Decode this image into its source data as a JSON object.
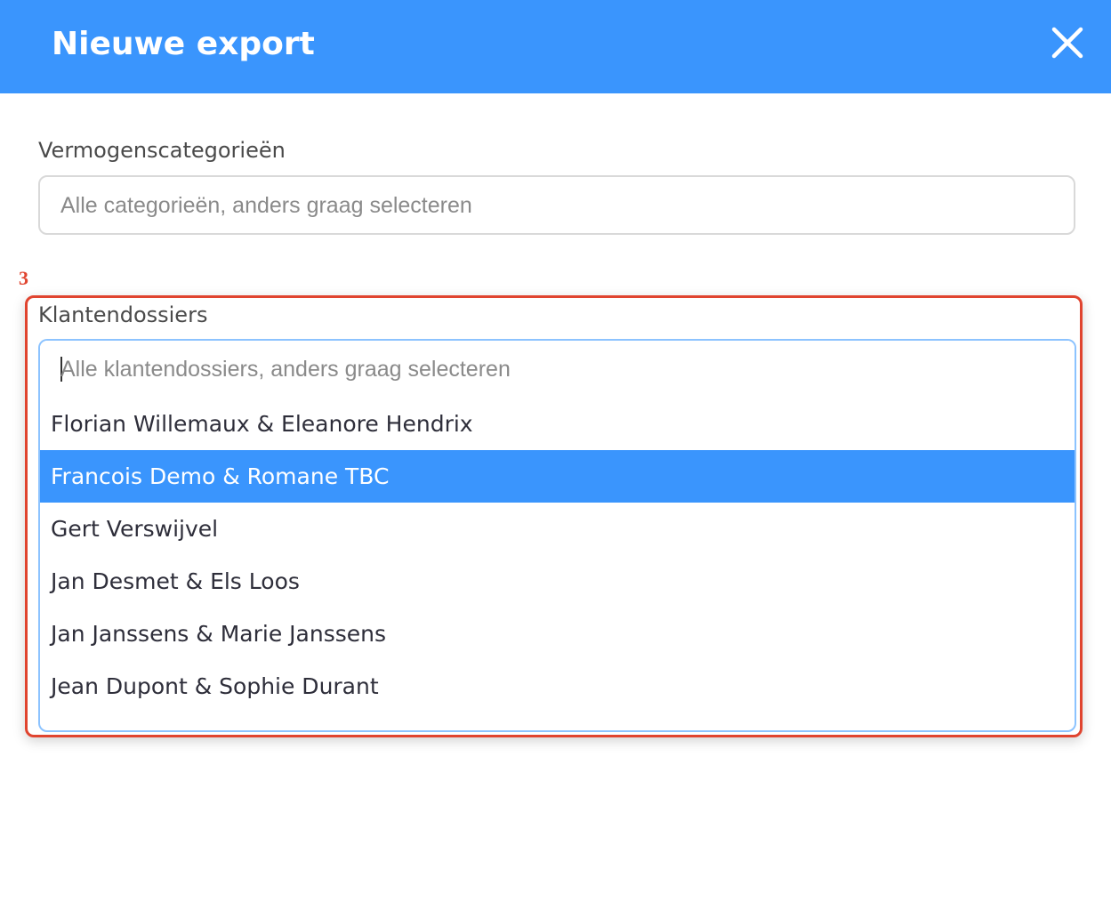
{
  "dialog": {
    "title": "Nieuwe export",
    "close_icon": "close-icon"
  },
  "categories": {
    "label": "Vermogenscategorieën",
    "placeholder": "Alle categorieën, anders graag selecteren"
  },
  "annotation": {
    "number": "3",
    "color": "#e0442f"
  },
  "clients": {
    "label": "Klantendossiers",
    "placeholder": "Alle klantendossiers, anders graag selecteren",
    "options": [
      "Florian Willemaux & Eleanore Hendrix",
      "Francois Demo & Romane TBC",
      "Gert Verswijvel",
      "Jan Desmet & Els Loos",
      "Jan Janssens & Marie Janssens",
      "Jean Dupont & Sophie Durant"
    ],
    "highlighted_option": "Francois Demo & Romane TBC"
  },
  "colors": {
    "header": "#3a95fd",
    "highlight": "#3a95fd",
    "focus_border": "#8cc3ff"
  }
}
